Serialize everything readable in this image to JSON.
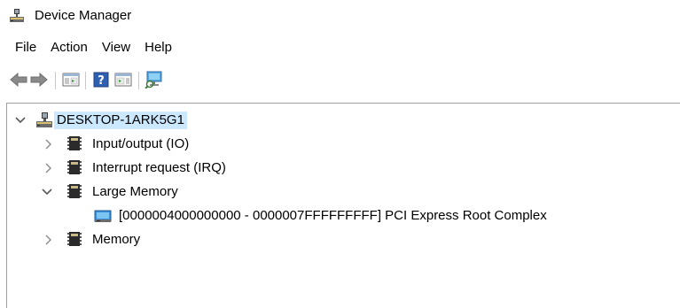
{
  "window": {
    "title": "Device Manager",
    "app_icon": "computer-icon"
  },
  "menu": {
    "items": [
      "File",
      "Action",
      "View",
      "Help"
    ]
  },
  "toolbar": {
    "buttons": [
      {
        "name": "back-button",
        "icon": "back-arrow-icon"
      },
      {
        "name": "forward-button",
        "icon": "forward-arrow-icon"
      },
      {
        "name": "show-hide-console-tree-button",
        "icon": "console-tree-icon"
      },
      {
        "name": "help-button",
        "icon": "help-icon"
      },
      {
        "name": "show-hide-action-pane-button",
        "icon": "action-pane-icon"
      },
      {
        "name": "scan-hardware-changes-button",
        "icon": "scan-monitor-icon"
      }
    ]
  },
  "tree": {
    "root": {
      "label": "DESKTOP-1ARK5G1",
      "expanded": true,
      "selected": true,
      "icon": "computer-icon"
    },
    "nodes": [
      {
        "label": "Input/output (IO)",
        "expanded": false,
        "icon": "chip-icon"
      },
      {
        "label": "Interrupt request (IRQ)",
        "expanded": false,
        "icon": "chip-icon"
      },
      {
        "label": "Large Memory",
        "expanded": true,
        "icon": "chip-icon",
        "children": [
          {
            "label": "[0000004000000000 - 0000007FFFFFFFFF]  PCI Express Root Complex",
            "icon": "system-device-icon"
          }
        ]
      },
      {
        "label": "Memory",
        "expanded": false,
        "icon": "chip-icon"
      }
    ]
  },
  "colors": {
    "selection": "#cce8ff",
    "border": "#a0a0a0",
    "arrow_blue": "#1f6fd1",
    "chevron": "#5a5a5a"
  }
}
